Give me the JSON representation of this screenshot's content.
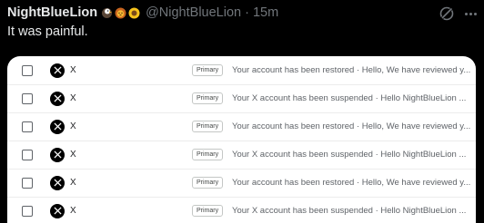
{
  "post": {
    "author_name": "NightBlueLion",
    "author_emojis": [
      "eagle-emoji",
      "lion-emoji",
      "sunflower-emoji"
    ],
    "handle": "@NightBlueLion",
    "separator": "·",
    "time": "15m",
    "text": "It was painful."
  },
  "inbox": {
    "rows": [
      {
        "sender": "X",
        "label": "Primary",
        "snippet": "Your account has been restored · Hello, We have reviewed y..."
      },
      {
        "sender": "X",
        "label": "Primary",
        "snippet": "Your X account has been suspended · Hello NightBlueLion ..."
      },
      {
        "sender": "X",
        "label": "Primary",
        "snippet": "Your account has been restored · Hello, We have reviewed y..."
      },
      {
        "sender": "X",
        "label": "Primary",
        "snippet": "Your X account has been suspended · Hello NightBlueLion ..."
      },
      {
        "sender": "X",
        "label": "Primary",
        "snippet": "Your account has been restored · Hello, We have reviewed y..."
      },
      {
        "sender": "X",
        "label": "Primary",
        "snippet": "Your X account has been suspended · Hello NightBlueLion ..."
      }
    ]
  },
  "colors": {
    "background": "#000000",
    "primary_text": "#e7e9ea",
    "secondary_text": "#71767b",
    "media_background": "#ffffff"
  }
}
